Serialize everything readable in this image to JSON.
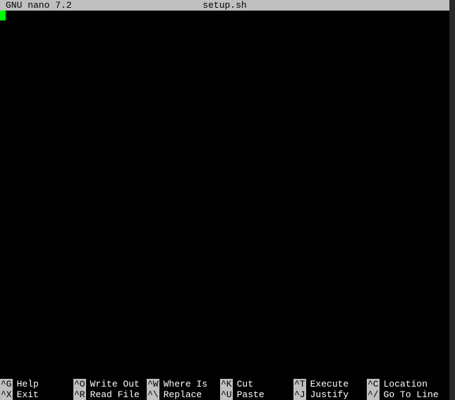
{
  "titlebar": {
    "app": "GNU nano 7.2",
    "filename": "setup.sh"
  },
  "helpbar": {
    "row1": [
      {
        "key": "^G",
        "label": "Help"
      },
      {
        "key": "^O",
        "label": "Write Out"
      },
      {
        "key": "^W",
        "label": "Where Is"
      },
      {
        "key": "^K",
        "label": "Cut"
      },
      {
        "key": "^T",
        "label": "Execute"
      },
      {
        "key": "^C",
        "label": "Location"
      }
    ],
    "row2": [
      {
        "key": "^X",
        "label": "Exit"
      },
      {
        "key": "^R",
        "label": "Read File"
      },
      {
        "key": "^\\",
        "label": "Replace"
      },
      {
        "key": "^U",
        "label": "Paste"
      },
      {
        "key": "^J",
        "label": "Justify"
      },
      {
        "key": "^/",
        "label": "Go To Line"
      }
    ]
  }
}
